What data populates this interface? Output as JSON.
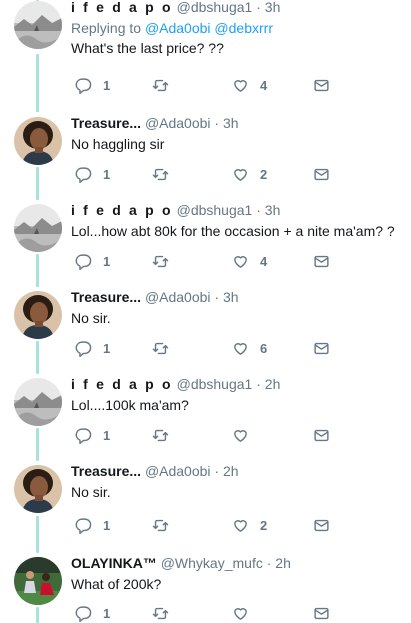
{
  "tweets": [
    {
      "name": "i f e d a p o",
      "handle": "@dbshuga1",
      "separator": "·",
      "time": "3h",
      "reply_prefix": "Replying to",
      "reply_mentions": "@Ada0obi @debxrrr",
      "text": "What's the last price? ??",
      "replies": "1",
      "retweets": "",
      "likes": "4",
      "avatar": "landscape"
    },
    {
      "name": "Treasure...",
      "handle": "@Ada0obi",
      "separator": "·",
      "time": "3h",
      "text": "No haggling sir",
      "replies": "1",
      "retweets": "",
      "likes": "2",
      "avatar": "woman"
    },
    {
      "name": "i f e d a p o",
      "handle": "@dbshuga1",
      "separator": "·",
      "time": "3h",
      "text": "Lol...how abt 80k for the occasion + a nite ma'am? ?",
      "replies": "1",
      "retweets": "",
      "likes": "4",
      "avatar": "landscape"
    },
    {
      "name": "Treasure...",
      "handle": "@Ada0obi",
      "separator": "·",
      "time": "3h",
      "text": "No sir.",
      "replies": "1",
      "retweets": "",
      "likes": "6",
      "avatar": "woman"
    },
    {
      "name": "i f e d a p o",
      "handle": "@dbshuga1",
      "separator": "·",
      "time": "2h",
      "text": "Lol....100k ma'am?",
      "replies": "1",
      "retweets": "",
      "likes": "",
      "avatar": "landscape"
    },
    {
      "name": "Treasure...",
      "handle": "@Ada0obi",
      "separator": "·",
      "time": "2h",
      "text": "No sir.",
      "replies": "1",
      "retweets": "",
      "likes": "2",
      "avatar": "woman"
    },
    {
      "name": "OLAYINKA™",
      "handle": "@Whykay_mufc",
      "separator": "·",
      "time": "2h",
      "text": "What of 200k?",
      "replies": "1",
      "retweets": "",
      "likes": "",
      "avatar": "football"
    }
  ],
  "icons": {
    "reply": "reply-icon",
    "retweet": "retweet-icon",
    "like": "like-icon",
    "message": "direct-message-icon"
  },
  "colors": {
    "thread_line": "#a6e3dc",
    "mention": "#1da1f2",
    "muted": "#657786",
    "text": "#14171a"
  }
}
